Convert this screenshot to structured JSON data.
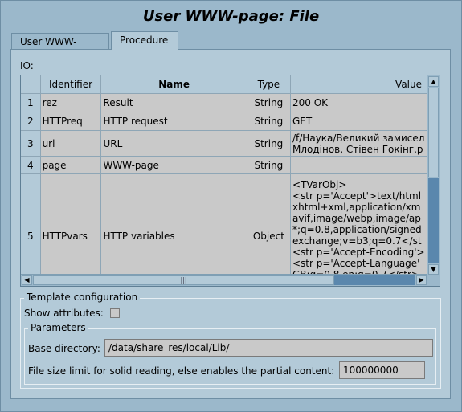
{
  "window": {
    "title": "User WWW-page: File"
  },
  "tabs": [
    {
      "label": "User WWW-page"
    },
    {
      "label": "Procedure"
    }
  ],
  "io": {
    "label": "IO:",
    "columns": [
      "",
      "Identifier",
      "Name",
      "Type",
      "Value"
    ],
    "rows": [
      {
        "num": "1",
        "id": "rez",
        "name": "Result",
        "type": "String",
        "value": "200 OK"
      },
      {
        "num": "2",
        "id": "HTTPreq",
        "name": "HTTP request",
        "type": "String",
        "value": "GET"
      },
      {
        "num": "3",
        "id": "url",
        "name": "URL",
        "type": "String",
        "value": "/f/Наука/Великий замисел\nМлодінов, Стівен Гокінг.р"
      },
      {
        "num": "4",
        "id": "page",
        "name": "WWW-page",
        "type": "String",
        "value": ""
      },
      {
        "num": "5",
        "id": "HTTPvars",
        "name": "HTTP variables",
        "type": "Object",
        "value": "<TVarObj>\n<str p='Accept'>text/html\nxhtml+xml,application/xm\navif,image/webp,image/ap\n*;q=0.8,application/signed\nexchange;v=b3;q=0.7</st\n<str p='Accept-Encoding'>\n<str p='Accept-Language'\nGB;q=0.8,en;q=0.7</str>"
      }
    ]
  },
  "template": {
    "title": "Template configuration",
    "show_attributes_label": "Show attributes:",
    "show_attributes_checked": false,
    "parameters": {
      "title": "Parameters",
      "base_dir_label": "Base directory:",
      "base_dir_value": "/data/share_res/local/Lib/",
      "size_limit_label": "File size limit for solid reading, else enables the partial content:",
      "size_limit_value": "100000000"
    }
  }
}
